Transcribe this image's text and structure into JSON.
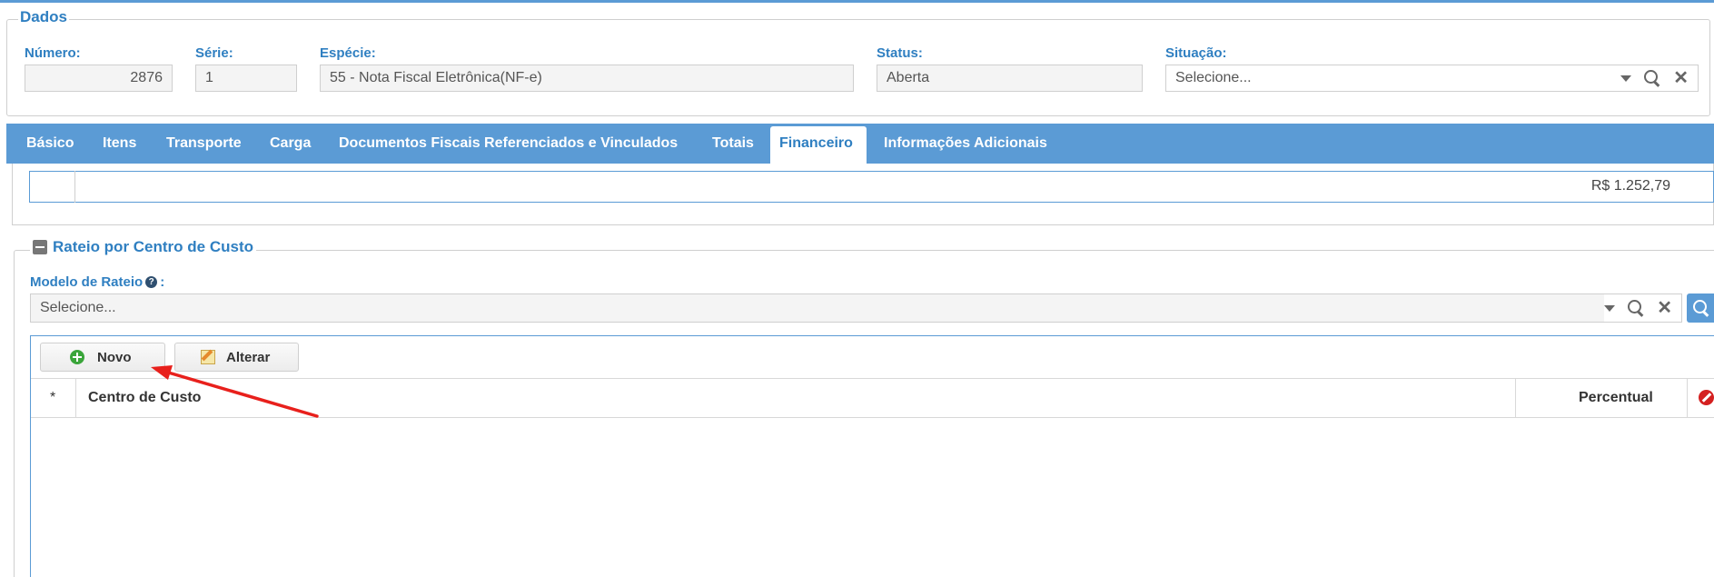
{
  "dados": {
    "legend": "Dados",
    "numero": {
      "label": "Número:",
      "value": "2876"
    },
    "serie": {
      "label": "Série:",
      "value": "1"
    },
    "especie": {
      "label": "Espécie:",
      "value": "55 - Nota Fiscal Eletrônica(NF-e)"
    },
    "status": {
      "label": "Status:",
      "value": "Aberta"
    },
    "situacao": {
      "label": "Situação:",
      "placeholder": "Selecione..."
    }
  },
  "tabs": [
    {
      "label": "Básico"
    },
    {
      "label": "Itens"
    },
    {
      "label": "Transporte"
    },
    {
      "label": "Carga"
    },
    {
      "label": "Documentos Fiscais Referenciados e Vinculados"
    },
    {
      "label": "Totais"
    },
    {
      "label": "Financeiro",
      "active": true
    },
    {
      "label": "Informações Adicionais"
    }
  ],
  "financeiro": {
    "total_value": "R$ 1.252,79"
  },
  "rateio": {
    "title": "Rateio por Centro de Custo",
    "modelo_label": "Modelo de Rateio",
    "modelo_suffix": ":",
    "modelo_placeholder": "Selecione...",
    "buttons": {
      "novo": "Novo",
      "alterar": "Alterar"
    },
    "columns": {
      "marker": "*",
      "centro": "Centro de Custo",
      "percentual": "Percentual"
    }
  },
  "icons": [
    "minus-icon",
    "help-icon",
    "chevron-down-icon",
    "search-icon",
    "close-icon",
    "plus-circle-icon",
    "pencil-icon",
    "delete-icon"
  ],
  "colors": {
    "accent": "#5b9bd5",
    "label": "#2f7fc1",
    "arrow": "#e8201c"
  }
}
